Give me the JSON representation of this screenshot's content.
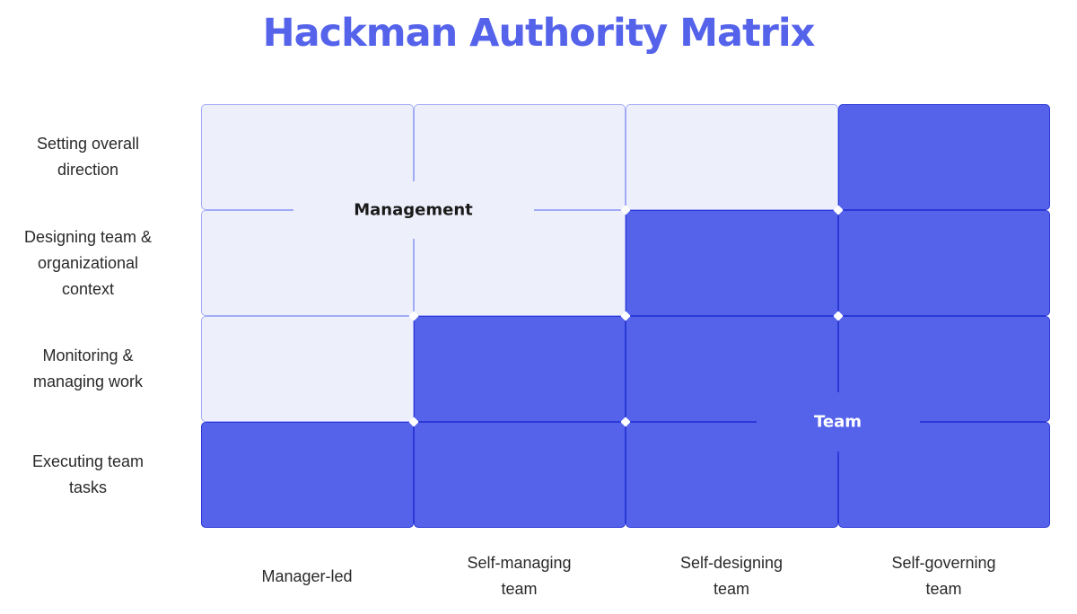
{
  "title": "Hackman Authority Matrix",
  "colors": {
    "accent": "#5563EB",
    "management_fill": "#EDEFFB",
    "management_border": "#A2ACF6",
    "team_fill": "#5563EB",
    "team_border": "#2B38D8",
    "title": "#5563EB",
    "management_label": "#1a1a1a",
    "team_label": "#ffffff"
  },
  "rows": [
    {
      "label": "Setting overall\ndirection"
    },
    {
      "label": "Designing team &\norganizational\ncontext"
    },
    {
      "label": "Monitoring &\nmanaging work"
    },
    {
      "label": "Executing team\ntasks"
    }
  ],
  "columns": [
    {
      "label": "Manager-led"
    },
    {
      "label": "Self-managing\nteam"
    },
    {
      "label": "Self-designing\nteam"
    },
    {
      "label": "Self-governing\nteam"
    }
  ],
  "matrix": [
    [
      "management",
      "management",
      "management",
      "team"
    ],
    [
      "management",
      "management",
      "team",
      "team"
    ],
    [
      "management",
      "team",
      "team",
      "team"
    ],
    [
      "team",
      "team",
      "team",
      "team"
    ]
  ],
  "regions": {
    "management": "Management",
    "team": "Team"
  }
}
